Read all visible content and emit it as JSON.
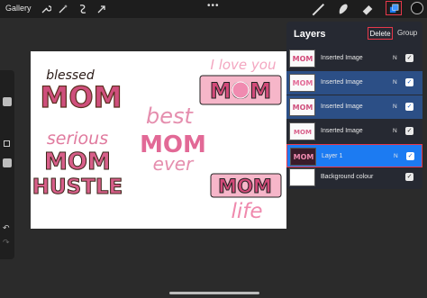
{
  "topbar": {
    "gallery_label": "Gallery",
    "more_label": "•••",
    "icons": [
      "wrench-icon",
      "magic-wand-icon",
      "selection-icon",
      "move-arrow-icon",
      "brush-icon",
      "smudge-icon",
      "eraser-icon",
      "layers-icon",
      "color-swatch"
    ]
  },
  "sidebar": {
    "undo_label": "↶",
    "redo_label": "↷"
  },
  "canvas": {
    "art": {
      "blessed": "blessed",
      "mom": "MOM",
      "serious": "serious",
      "hustle": "HUSTLE",
      "best": "best",
      "ever": "ever",
      "love_you": "I love you",
      "life": "life"
    }
  },
  "layers_panel": {
    "title": "Layers",
    "delete_label": "Delete",
    "group_label": "Group",
    "layers": [
      {
        "name": "Inserted Image",
        "blend": "N",
        "checked": "✓"
      },
      {
        "name": "Inserted Image",
        "blend": "N",
        "checked": "✓"
      },
      {
        "name": "Inserted Image",
        "blend": "N",
        "checked": "✓"
      },
      {
        "name": "Inserted Image",
        "blend": "N",
        "checked": "✓"
      },
      {
        "name": "Layer 1",
        "blend": "N",
        "checked": "✓"
      },
      {
        "name": "Background colour",
        "blend": "",
        "checked": "✓"
      }
    ]
  },
  "colors": {
    "accent_blue": "#1c7bf2",
    "selected_row": "#2c4f86",
    "highlight_red": "#e8384a",
    "pink": "#e76b93"
  }
}
